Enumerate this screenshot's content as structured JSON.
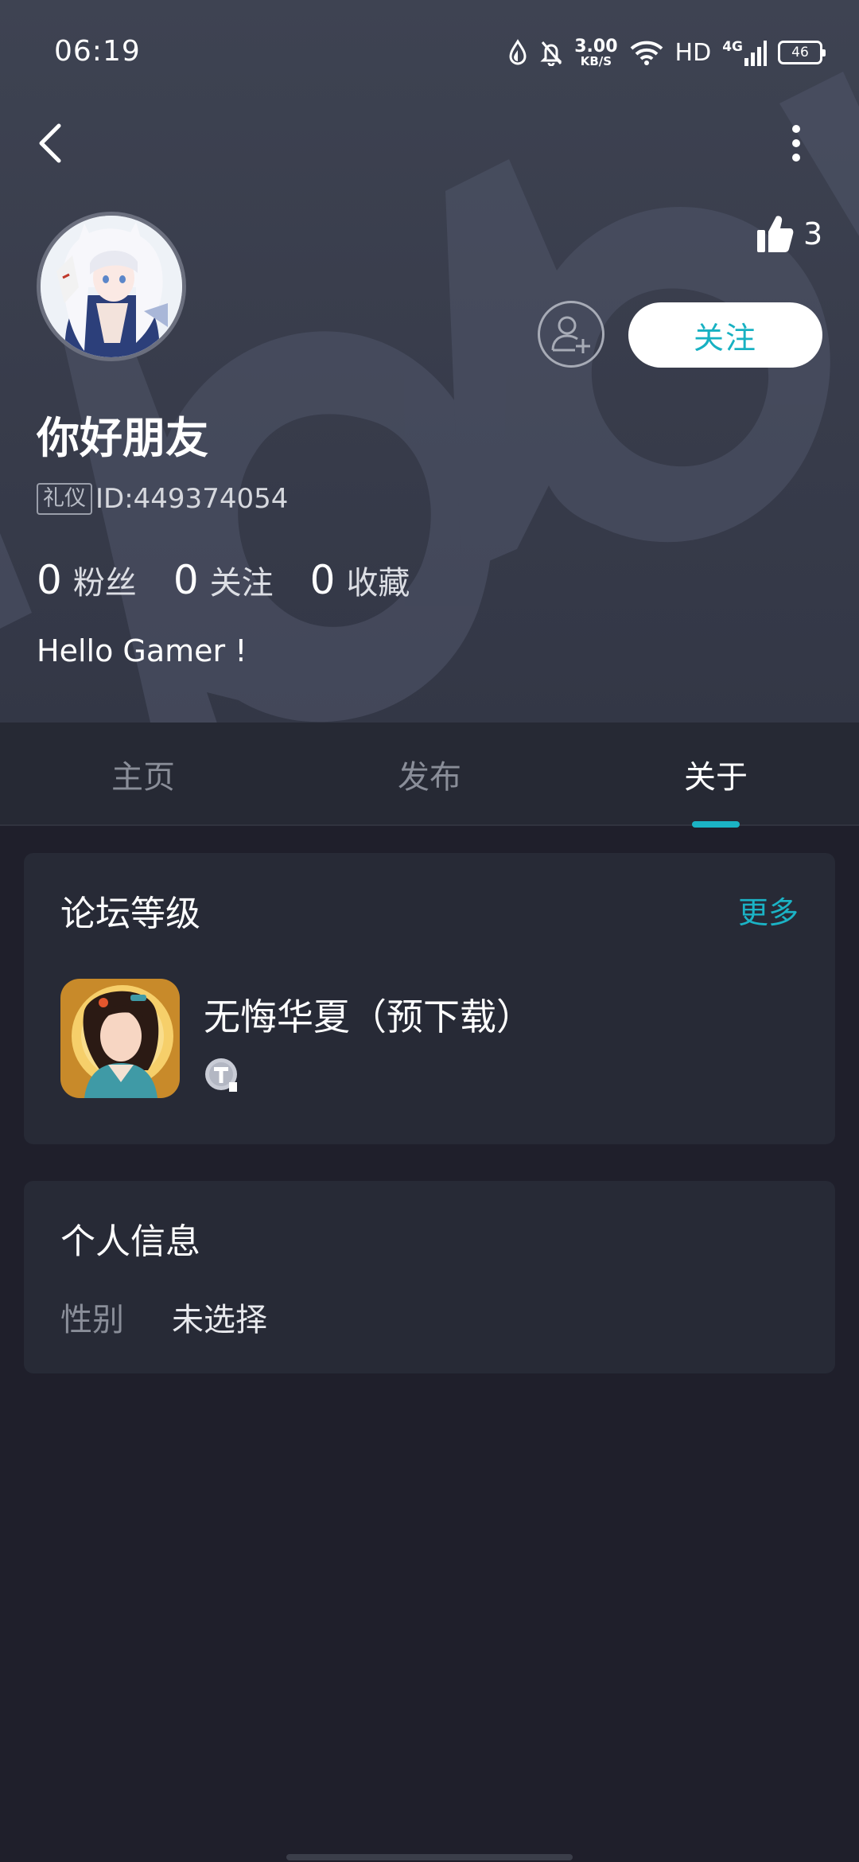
{
  "status_bar": {
    "time": "06:19",
    "net_speed_value": "3.00",
    "net_speed_unit": "KB/S",
    "hd_label": "HD",
    "network_label": "4G",
    "battery_level": "46"
  },
  "profile": {
    "like_count": "3",
    "follow_button_label": "关注",
    "username": "你好朋友",
    "id_tag": "礼仪",
    "id_text": "ID:449374054",
    "stats": [
      {
        "value": "0",
        "label": "粉丝"
      },
      {
        "value": "0",
        "label": "关注"
      },
      {
        "value": "0",
        "label": "收藏"
      }
    ],
    "bio": "Hello Gamer !"
  },
  "tabs": [
    {
      "label": "主页",
      "active": false
    },
    {
      "label": "发布",
      "active": false
    },
    {
      "label": "关于",
      "active": true
    }
  ],
  "forum_card": {
    "title": "论坛等级",
    "more_label": "更多",
    "game_name": "无悔华夏（预下载）"
  },
  "info_card": {
    "title": "个人信息",
    "gender_label": "性别",
    "gender_value": "未选择"
  },
  "colors": {
    "accent": "#1bb3c5",
    "background": "#1f1f2b",
    "header": "#3a3e4d",
    "card": "#272a36"
  },
  "icons": {
    "back": "chevron-left-icon",
    "more": "vertical-dots-icon",
    "like": "thumbs-up-icon",
    "add_friend": "add-user-icon",
    "level": "level-badge-icon"
  }
}
